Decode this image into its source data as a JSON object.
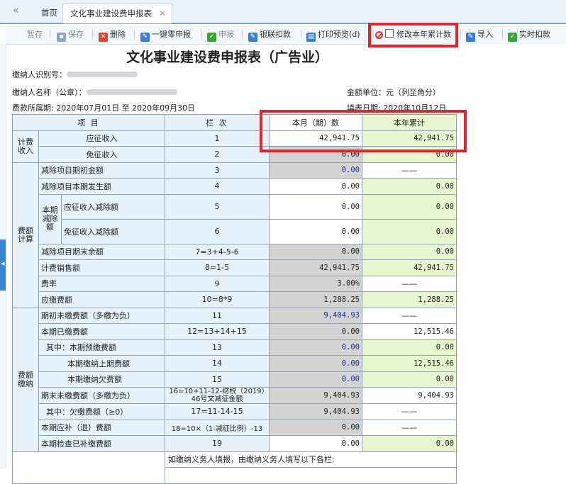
{
  "tabs": {
    "back_icon": "«",
    "home": "首页",
    "active": "文化事业建设费申报表",
    "close": "✕"
  },
  "toolbar": {
    "save_draft": "暂存",
    "save": "保存",
    "delete": "删除",
    "zero_declare": "一键零申报",
    "declare": "申报",
    "bank_deduct": "银联扣款",
    "print_preview": "打印预览(d)",
    "edit_cumulative": "修改本年累计数",
    "import": "导入",
    "realtime_deduct": "实时扣款"
  },
  "form": {
    "title": "文化事业建设费申报表（广告业）",
    "taxpayer_id_label": "缴纳人识别号：",
    "taxpayer_name_label": "缴纳人名称（公章）：",
    "amount_unit": "金额单位：元（列至角分）",
    "period": "费款所属期: 2020年07月01日 至 2020年09月30日",
    "fill_date": "填表日期: 2020年10月12日",
    "headers": {
      "item": "项 目",
      "col": "栏 次",
      "current": "本月（期）数",
      "year": "本年累计"
    },
    "groups": {
      "g1": "计费收入",
      "g2": "费额计算",
      "g2_sub": "本期减除额",
      "g3": "费额缴纳"
    },
    "rows": [
      {
        "label": "应征收入",
        "col": "1",
        "current": "42,941.75",
        "year": "42,941.75"
      },
      {
        "label": "免征收入",
        "col": "2",
        "current": "0.00",
        "year": "0.00"
      },
      {
        "label": "减除项目期初金额",
        "col": "3",
        "current": "0.00",
        "year": "——"
      },
      {
        "label": "减除项目本期发生额",
        "col": "4",
        "current": "0.00",
        "year": "0.00"
      },
      {
        "label": "应征收入减除额",
        "col": "5",
        "current": "0.00",
        "year": "0.00"
      },
      {
        "label": "免征收入减除额",
        "col": "6",
        "current": "0.00",
        "year": "0.00"
      },
      {
        "label": "减除项目期末余额",
        "col": "7=3+4-5-6",
        "current": "0.00",
        "year": "0.00"
      },
      {
        "label": "计费销售额",
        "col": "8=1-5",
        "current": "42,941.75",
        "year": "42,941.75"
      },
      {
        "label": "费率",
        "col": "9",
        "current": "3.00%",
        "year": "——"
      },
      {
        "label": "应缴费额",
        "col": "10=8*9",
        "current": "1,288.25",
        "year": "1,288.25"
      },
      {
        "label": "期初未缴费额（多缴为负）",
        "col": "11",
        "current": "9,404.93",
        "year": "——"
      },
      {
        "label": "本期已缴费额",
        "col": "12=13+14+15",
        "current": "0.00",
        "year": "12,515.46"
      },
      {
        "label": "其中：本期预缴费额",
        "col": "13",
        "current": "0.00",
        "year": "0.00"
      },
      {
        "label": "本期缴纳上期费额",
        "col": "14",
        "current": "0.00",
        "year": "12,515.46"
      },
      {
        "label": "本期缴纳欠费额",
        "col": "15",
        "current": "0.00",
        "year": "0.00"
      },
      {
        "label": "期末未缴费额（多缴为负）",
        "col": "16=10+11-12-财税（2019）46号文减征金额",
        "current": "9,404.93",
        "year": "9,404.93"
      },
      {
        "label": "其中：欠缴费额（≥0）",
        "col": "17=11-14-15",
        "current": "9,404.93",
        "year": "——"
      },
      {
        "label": "本期应补（退）费额",
        "col": "18=10×（1-减征比例）-13",
        "current": "0.00",
        "year": "——"
      },
      {
        "label": "本期检查已补缴费额",
        "col": "19",
        "current": "0.00",
        "year": "0.00"
      }
    ],
    "footer_note": "如缴纳义务人填报，由缴纳义务人填写以下各栏:"
  }
}
